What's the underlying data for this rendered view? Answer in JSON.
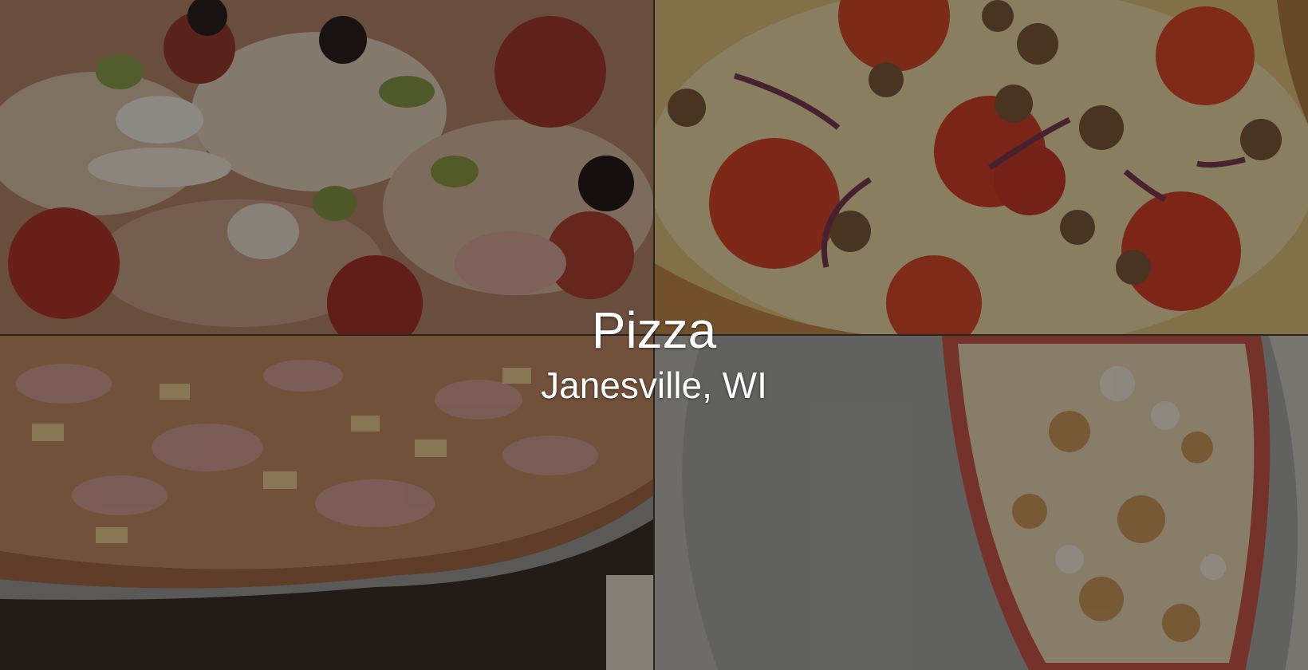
{
  "caption": {
    "title": "Pizza",
    "subtitle": "Janesville, WI"
  },
  "photos": [
    {
      "name": "supreme-pizza-closeup",
      "description_colors": {
        "base": "#c08a6a",
        "accent": "#b3342a"
      }
    },
    {
      "name": "tomato-sausage-onion-pizza",
      "description_colors": {
        "base": "#d9b56a",
        "accent": "#d7452a"
      }
    },
    {
      "name": "ham-pineapple-pizza-on-tray",
      "description_colors": {
        "base": "#b57a56",
        "accent": "#6b4a3c"
      }
    },
    {
      "name": "cheese-pizza-slice-on-tray",
      "description_colors": {
        "base": "#9a9a9a",
        "accent": "#d8b890"
      }
    }
  ],
  "colors": {
    "text": "#ffffff",
    "overlay": "rgba(0,0,0,0.42)"
  }
}
